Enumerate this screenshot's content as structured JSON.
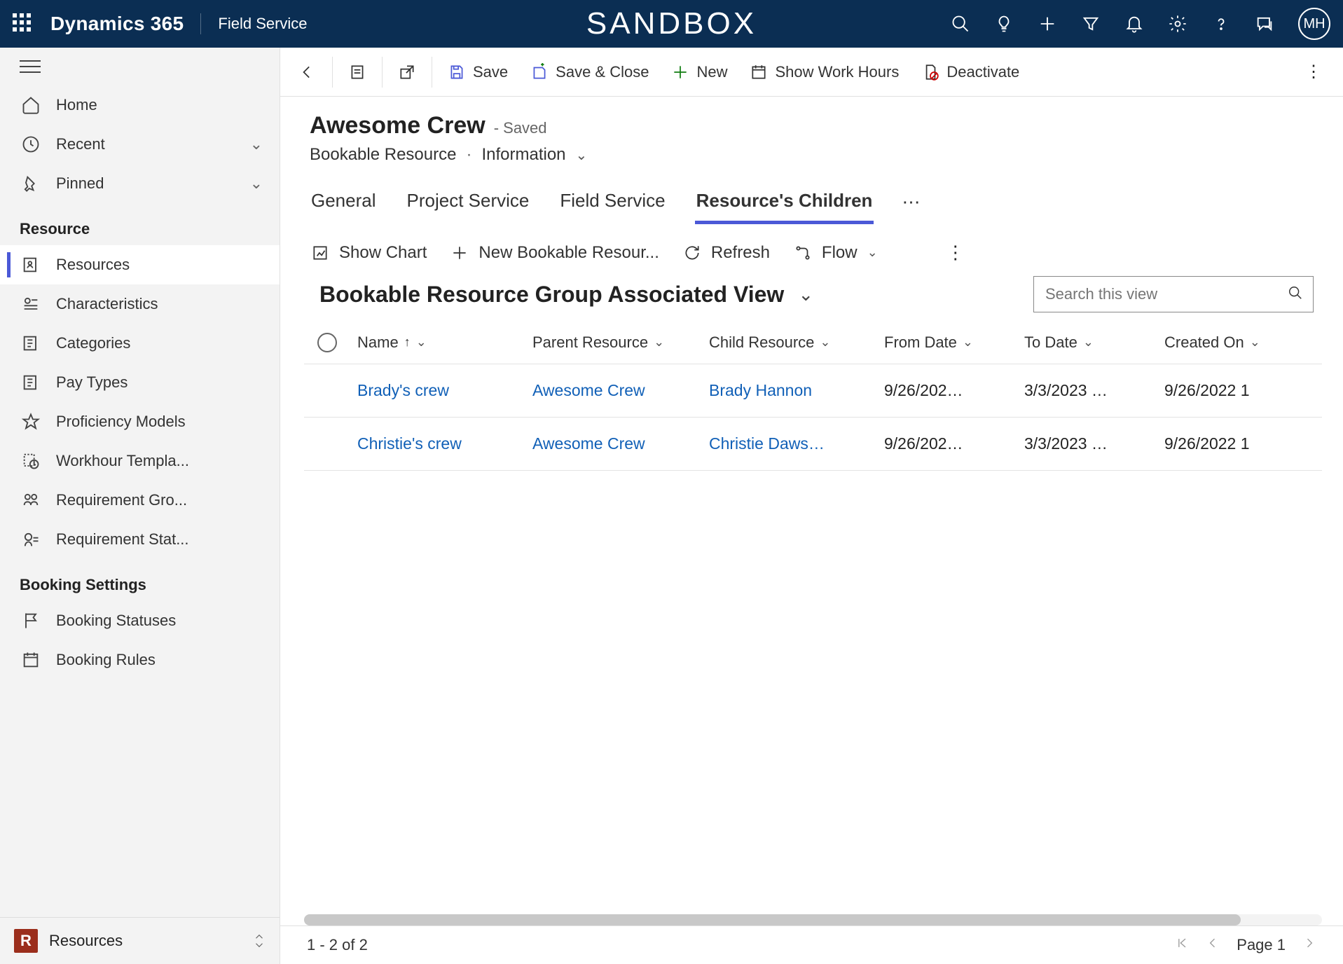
{
  "header": {
    "brand": "Dynamics 365",
    "app": "Field Service",
    "environment": "SANDBOX",
    "avatar_initials": "MH"
  },
  "commandbar": {
    "back": "Back",
    "save": "Save",
    "save_close": "Save & Close",
    "new": "New",
    "show_work_hours": "Show Work Hours",
    "deactivate": "Deactivate"
  },
  "form": {
    "title": "Awesome Crew",
    "saved_marker": "- Saved",
    "entity": "Bookable Resource",
    "form_name": "Information"
  },
  "tabs": {
    "general": "General",
    "project_service": "Project Service",
    "field_service": "Field Service",
    "resources_children": "Resource's Children"
  },
  "subgrid": {
    "show_chart": "Show Chart",
    "new_bookable": "New Bookable Resour...",
    "refresh": "Refresh",
    "flow": "Flow",
    "view_name": "Bookable Resource Group Associated View",
    "search_placeholder": "Search this view",
    "columns": {
      "name": "Name",
      "parent": "Parent Resource",
      "child": "Child Resource",
      "from": "From Date",
      "to": "To Date",
      "created": "Created On"
    },
    "rows": [
      {
        "name": "Brady's crew",
        "parent": "Awesome Crew",
        "child": "Brady Hannon",
        "from": "9/26/202…",
        "to": "3/3/2023 …",
        "created": "9/26/2022 1"
      },
      {
        "name": "Christie's crew",
        "parent": "Awesome Crew",
        "child": "Christie Daws…",
        "from": "9/26/202…",
        "to": "3/3/2023 …",
        "created": "9/26/2022 1"
      }
    ]
  },
  "sidebar": {
    "home": "Home",
    "recent": "Recent",
    "pinned": "Pinned",
    "section_resource": "Resource",
    "resources": "Resources",
    "characteristics": "Characteristics",
    "categories": "Categories",
    "pay_types": "Pay Types",
    "proficiency": "Proficiency Models",
    "workhour_templates": "Workhour Templa...",
    "requirement_groups": "Requirement Gro...",
    "requirement_statuses": "Requirement Stat...",
    "section_booking": "Booking Settings",
    "booking_statuses": "Booking Statuses",
    "booking_rules": "Booking Rules",
    "area_switch_letter": "R",
    "area_switch_label": "Resources"
  },
  "footer": {
    "record_count": "1 - 2 of 2",
    "page_label": "Page 1"
  }
}
